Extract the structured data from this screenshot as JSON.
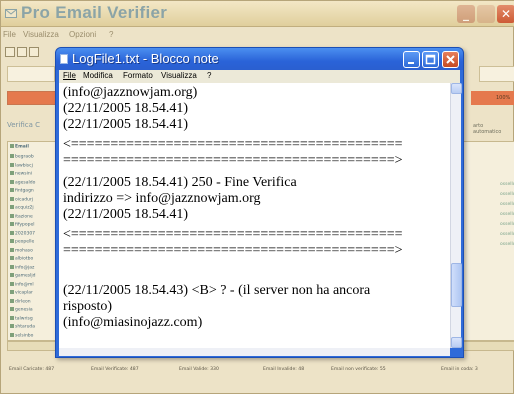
{
  "app": {
    "title": "Pro Email Verifier",
    "menu": [
      "File",
      "Visualizza",
      "Opzioni",
      "?"
    ],
    "progress_label": "100%",
    "verifica_label": "Verifica C",
    "automatic_label": "arto automatico",
    "list_header": "Email",
    "list_rows": [
      "begraob",
      "lawbiscj",
      "newsini",
      "agesaldo",
      "fintgagn",
      "oicadurj",
      "acquiz2j",
      "itazione",
      "fifypopel",
      "2020307",
      "peopelle",
      "mohaso",
      "albiotbo",
      "info@jaz",
      "gamesljd",
      "info@ml",
      "vicaplar",
      "dirleon",
      "genesia",
      "talwrisg",
      "shtaruda",
      "selsinbo"
    ],
    "right_rows": [
      "ossello",
      "ossello",
      "ossello",
      "ossello",
      "ossello",
      "ossello",
      "ossello"
    ],
    "status": [
      "Email Caricate: 487",
      "Email Verificate: 487",
      "Email Valide: 330",
      "Email Invalide: 48",
      "Email non verificate: 55",
      "Email in coda: 3"
    ]
  },
  "notepad": {
    "title": "LogFile1.txt - Blocco note",
    "menu": [
      "File",
      "Modifica",
      "Formato",
      "Visualizza",
      "?"
    ],
    "lines": [
      "(info@jazznowjam.org)",
      "(22/11/2005 18.54.41)",
      "(22/11/2005 18.54.41)",
      "<==========================================",
      "==========================================>",
      "(22/11/2005 18.54.41)                250 - Fine Verifica",
      "indirizzo => info@jazznowjam.org",
      "(22/11/2005 18.54.41)",
      "<==========================================",
      "==========================================>",
      "",
      "(22/11/2005 18.54.43) <B> ? - (il server non ha ancora",
      "risposto)",
      "(info@miasinojazz.com)"
    ]
  }
}
